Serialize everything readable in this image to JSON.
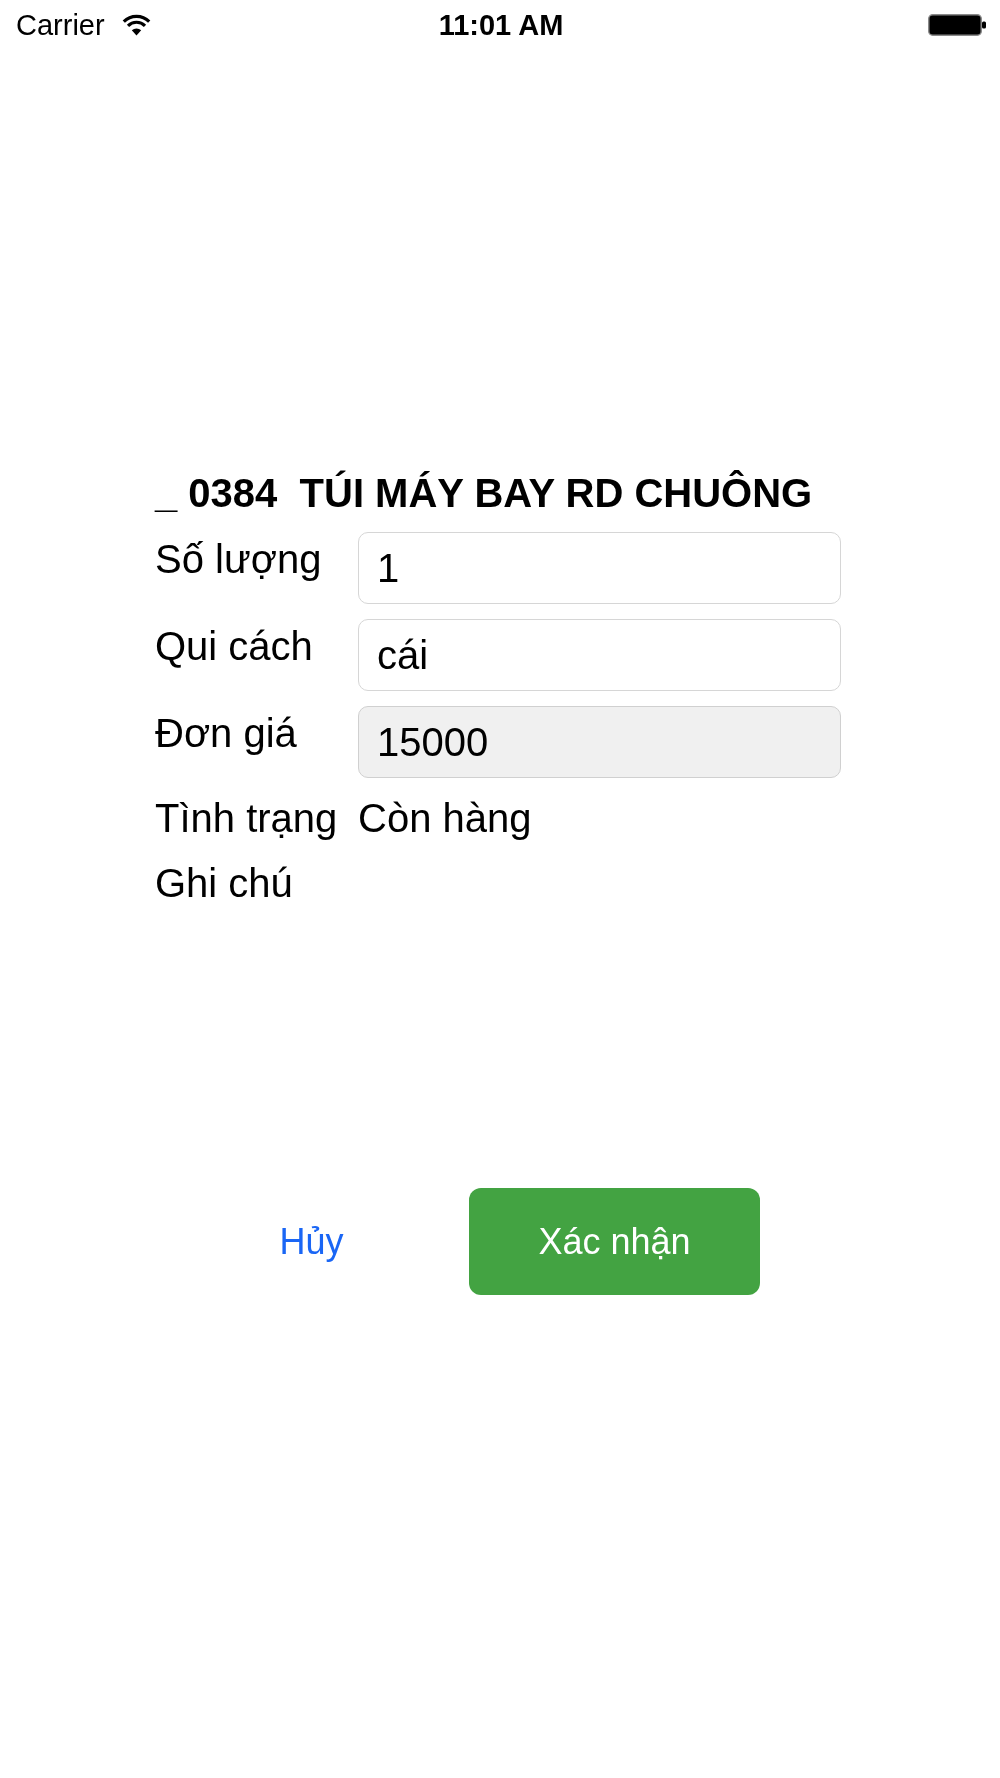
{
  "status_bar": {
    "carrier": "Carrier",
    "time": "11:01 AM"
  },
  "product": {
    "title": "_ 0384  TÚI MÁY BAY RD CHUÔNG"
  },
  "fields": [
    {
      "kind": "input",
      "label": "Số lượng",
      "value": "1",
      "disabled": false
    },
    {
      "kind": "input",
      "label": "Qui cách",
      "value": "cái",
      "disabled": false
    },
    {
      "kind": "input",
      "label": "Đơn giá",
      "value": "15000",
      "disabled": true
    },
    {
      "kind": "text",
      "label": "Tình trạng",
      "value": "Còn hàng"
    },
    {
      "kind": "text",
      "label": "Ghi chú"
    }
  ],
  "buttons": [
    {
      "kind": "link",
      "label": "Hủy"
    },
    {
      "kind": "primary",
      "label": "Xác nhận"
    }
  ]
}
